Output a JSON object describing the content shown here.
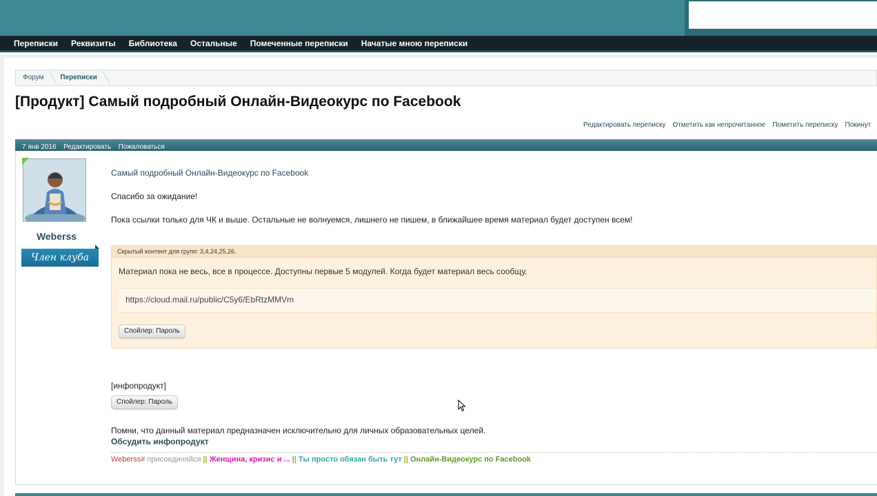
{
  "nav": {
    "items": [
      "Переписки",
      "Реквизиты",
      "Библиотека",
      "Остальные",
      "Помеченные переписки",
      "Начатые мною переписки"
    ]
  },
  "breadcrumb": [
    "Форум",
    "Переписки"
  ],
  "page_title": "[Продукт] Самый подробный Онлайн-Видеокурс по Facebook",
  "thread_links": [
    "Редактировать переписку",
    "Отметить как непрочитанное",
    "Пометить переписку",
    "Покинут"
  ],
  "post": {
    "date": "7 янв 2016",
    "edit_label": "Редактировать",
    "report_label": "Пожаловаться",
    "author": {
      "username": "Weberss",
      "rank": "Член клуба"
    },
    "title": "Самый подробный Онлайн-Видеокурс по Facebook",
    "line1": "Спасибо за ожидание!",
    "line2": "Пока ссылки только для ЧК и выше. Остальные не волнуемся, лишнего не пишем, в ближайшее время материал будет доступен всем!",
    "hidden": {
      "header": "Скрытый контент для групп: 3,4,24,25,26.",
      "text": "Материал пока не весь, все в процессе. Доступны первые 5 модулей. Когда будет материал весь сообщу.",
      "url": "https://cloud.mail.ru/public/C5y6/EbRtzMMVm",
      "spoiler_button": "Спойлер: Пароль"
    },
    "tag": "[инфопродукт]",
    "spoiler_button_2": "Спойлер: Пароль",
    "disclaimer": "Помни, что данный материал предназначен исключительно для личных образовательных целей.",
    "discuss_link": "Обсудить инфопродукт"
  },
  "signature": {
    "user": "Weberss#",
    "joined": "присоединяйся",
    "sep": "||",
    "link1": "Женщина, кризис и ...",
    "link2": "Ты просто обязан быть тут",
    "link3": "Онлайн-Видеокурс по Facebook"
  },
  "colors": {
    "banner": "#3d8a94",
    "navbar": "#16232b",
    "post_header": "#2c6474",
    "hidden_bg": "#fdf1dd",
    "rank_bg": "#1a6d95"
  }
}
